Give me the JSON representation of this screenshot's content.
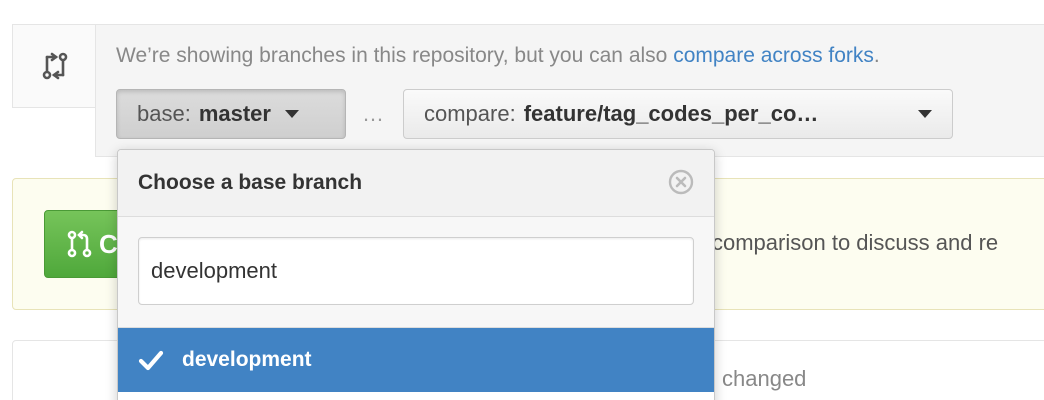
{
  "compare": {
    "notice_text": "We’re showing branches in this repository, but you can also ",
    "notice_link": "compare across forks",
    "notice_end": ".",
    "base_prefix": "base:",
    "base_branch": "master",
    "separator": "…",
    "compare_prefix": "compare:",
    "compare_branch": "feature/tag_codes_per_co…"
  },
  "flash": {
    "button_label": "C",
    "text": "comparison to discuss and re"
  },
  "files": {
    "text": "changed"
  },
  "dropdown": {
    "title": "Choose a base branch",
    "filter_value": "development",
    "items": [
      {
        "label": "development",
        "selected": true
      }
    ]
  },
  "colors": {
    "link": "#4183c4",
    "selected_bg": "#4183c4",
    "create_green": "#5cb545"
  },
  "icons": {
    "compare": "git-compare-icon",
    "pull_request": "pull-request-icon",
    "close": "close-circle-icon",
    "check": "check-icon",
    "caret": "caret-down-icon"
  }
}
